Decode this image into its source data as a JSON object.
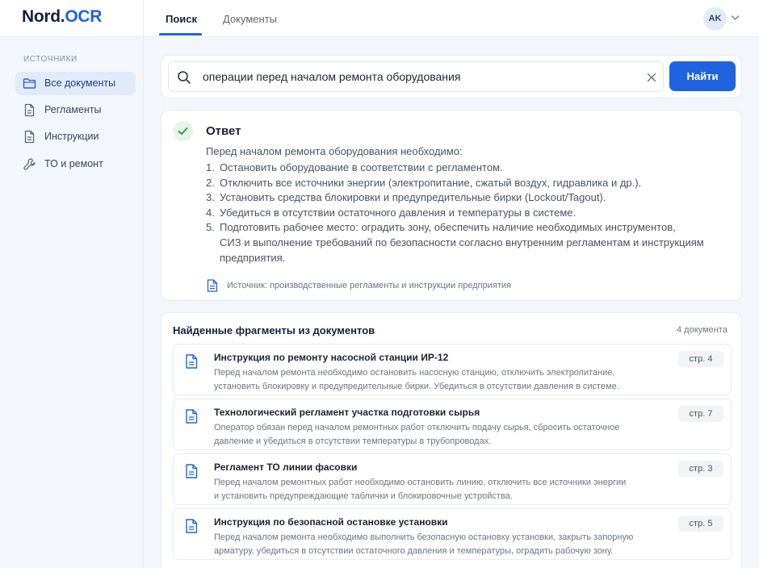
{
  "app": {
    "logo_main": "Nord.",
    "logo_accent": "OCR"
  },
  "colors": {
    "accent": "#1f63e0",
    "success": "#2e9e4f"
  },
  "tabs": [
    {
      "label": "Поиск",
      "active": true
    },
    {
      "label": "Документы",
      "active": false
    }
  ],
  "user": {
    "initials": "AK"
  },
  "sidebar": {
    "heading": "источники",
    "items": [
      {
        "label": "Все документы",
        "icon": "folder-icon",
        "active": true
      },
      {
        "label": "Регламенты",
        "icon": "document-icon",
        "active": false
      },
      {
        "label": "Инструкции",
        "icon": "document-icon",
        "active": false
      },
      {
        "label": "ТО и ремонт",
        "icon": "wrench-icon",
        "active": false
      }
    ]
  },
  "search": {
    "value": "операции перед началом ремонта оборудования",
    "button_label": "Найти"
  },
  "answer": {
    "title": "Ответ",
    "intro": "Перед началом ремонта оборудования необходимо:",
    "steps": [
      {
        "num": "1.",
        "lines": [
          "Остановить оборудование в соответствии с регламентом."
        ]
      },
      {
        "num": "2.",
        "lines": [
          "Отключить все источники энергии (электропитание, сжатый воздух, гидравлика и др.)."
        ]
      },
      {
        "num": "3.",
        "lines": [
          "Установить средства блокировки и предупредительные бирки (Lockout/Tagout)."
        ]
      },
      {
        "num": "4.",
        "lines": [
          "Убедиться в отсутствии остаточного давления и температуры в системе."
        ]
      },
      {
        "num": "5.",
        "lines": [
          "Подготовить рабочее место: оградить зону, обеспечить наличие необходимых инструментов,",
          "СИЗ и выполнение требований по безопасности согласно внутренним регламентам и инструкциям",
          "предприятия."
        ]
      }
    ],
    "source": "Источник: производственные регламенты и инструкции предприятия"
  },
  "results": {
    "title": "Найденные фрагменты из документов",
    "count": "4 документа",
    "items": [
      {
        "title": "Инструкция по ремонту насосной станции ИР-12",
        "snippet": [
          "Перед началом ремонта необходимо остановить насосную станцию, отключить электропитание,",
          "установить блокировку и предупредительные бирки. Убедиться в отсутствии давления в системе."
        ],
        "page": "стр. 4"
      },
      {
        "title": "Технологический регламент участка подготовки сырья",
        "snippet": [
          "Оператор обязан перед началом ремонтных работ отключить подачу сырья, сбросить остаточное",
          "давление и убедиться в отсутствии температуры в трубопроводах."
        ],
        "page": "стр. 7"
      },
      {
        "title": "Регламент ТО линии фасовки",
        "snippet": [
          "Перед началом ремонтных работ необходимо остановить линию, отключить все источники энергии",
          "и установить предупреждающие таблички и блокировочные устройства."
        ],
        "page": "стр. 3"
      },
      {
        "title": "Инструкция по безопасной остановке установки",
        "snippet": [
          "Перед началом ремонта необходимо выполнить безопасную остановку установки, закрыть запорную",
          "арматуру, убедиться в отсутствии остаточного давления и температуры, оградить рабочую зону."
        ],
        "page": "стр. 5"
      }
    ]
  }
}
